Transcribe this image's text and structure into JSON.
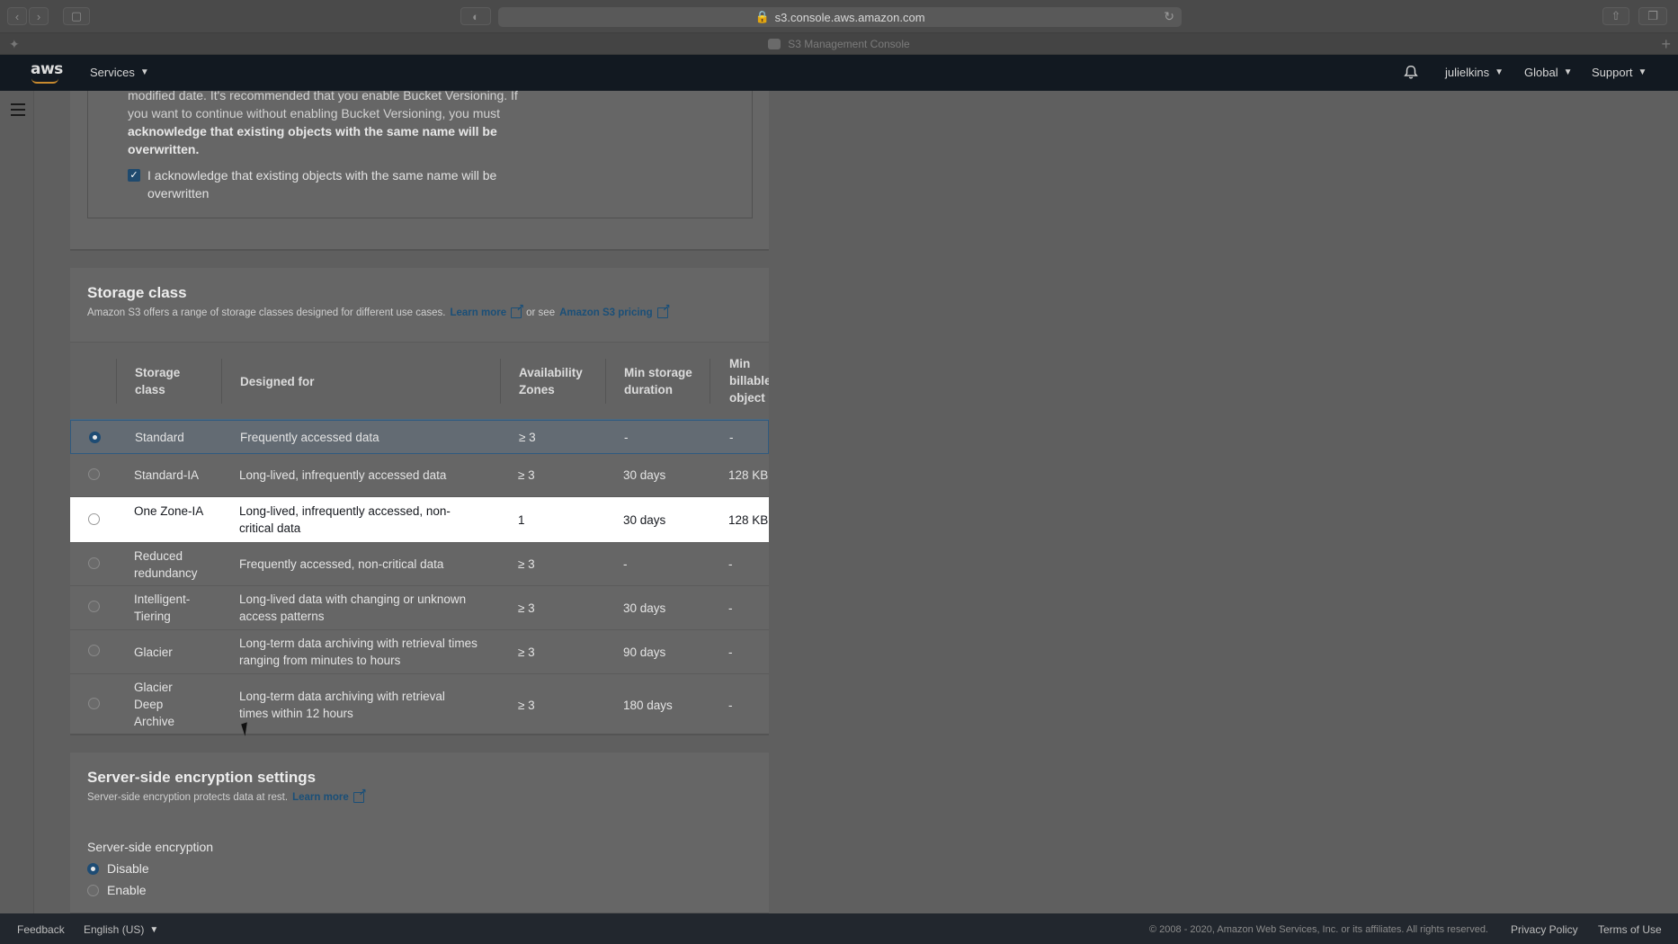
{
  "browser": {
    "url": "s3.console.aws.amazon.com",
    "tab_title": "S3 Management Console"
  },
  "navbar": {
    "logo": "aws",
    "services": "Services",
    "user": "julielkins",
    "region": "Global",
    "support": "Support"
  },
  "versioning_warning": {
    "line1": "modified date. It's recommended that you enable Bucket Versioning. If",
    "line2": "you want to continue without enabling Bucket Versioning, you must",
    "bold": "acknowledge that existing objects with the same name will be overwritten.",
    "ack_label": "I acknowledge that existing objects with the same name will be overwritten"
  },
  "storage_class": {
    "title": "Storage class",
    "desc": "Amazon S3 offers a range of storage classes designed for different use cases.",
    "learn_more": "Learn more",
    "or_see": "or see",
    "pricing": "Amazon S3 pricing",
    "headers": {
      "class": "Storage class",
      "designed": "Designed for",
      "az": "Availability Zones",
      "min_duration": "Min storage duration",
      "min_object": "Min billable object"
    },
    "rows": [
      {
        "name": "Standard",
        "designed": "Frequently accessed data",
        "az": "≥ 3",
        "duration": "-",
        "object": "-"
      },
      {
        "name": "Standard-IA",
        "designed": "Long-lived, infrequently accessed data",
        "az": "≥ 3",
        "duration": "30 days",
        "object": "128 KB"
      },
      {
        "name": "One Zone-IA",
        "designed": "Long-lived, infrequently accessed, non-critical data",
        "az": "1",
        "duration": "30 days",
        "object": "128 KB"
      },
      {
        "name": "Reduced redundancy",
        "designed": "Frequently accessed, non-critical data",
        "az": "≥ 3",
        "duration": "-",
        "object": "-"
      },
      {
        "name": "Intelligent-Tiering",
        "designed": "Long-lived data with changing or unknown access patterns",
        "az": "≥ 3",
        "duration": "30 days",
        "object": "-"
      },
      {
        "name": "Glacier",
        "designed": "Long-term data archiving with retrieval times ranging from minutes to hours",
        "az": "≥ 3",
        "duration": "90 days",
        "object": "-"
      },
      {
        "name": "Glacier Deep Archive",
        "designed": "Long-term data archiving with retrieval times within 12 hours",
        "az": "≥ 3",
        "duration": "180 days",
        "object": "-"
      }
    ]
  },
  "encryption": {
    "title": "Server-side encryption settings",
    "desc": "Server-side encryption protects data at rest.",
    "learn_more": "Learn more",
    "label": "Server-side encryption",
    "disable": "Disable",
    "enable": "Enable"
  },
  "footer": {
    "feedback": "Feedback",
    "language": "English (US)",
    "copyright": "© 2008 - 2020, Amazon Web Services, Inc. or its affiliates. All rights reserved.",
    "privacy": "Privacy Policy",
    "terms": "Terms of Use"
  }
}
